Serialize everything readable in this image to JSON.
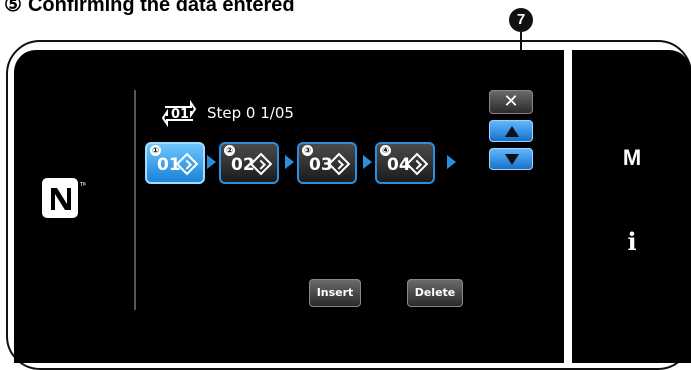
{
  "heading": {
    "number": "⑤",
    "text": "Confirming the data entered"
  },
  "callout": {
    "label": "7"
  },
  "title": {
    "text": "Step 0 1/05",
    "icon": "step-loop-icon"
  },
  "steps": [
    {
      "number": "①",
      "code": "01",
      "state": "active",
      "icon": "diamond-arrow-icon"
    },
    {
      "number": "②",
      "code": "02",
      "state": "inactive",
      "icon": "diamond-arrow-icon"
    },
    {
      "number": "③",
      "code": "03",
      "state": "inactive",
      "icon": "diamond-arrow-icon"
    },
    {
      "number": "④",
      "code": "04",
      "state": "inactive",
      "icon": "diamond-arrow-icon"
    }
  ],
  "buttons": {
    "close": "✕",
    "insert": "Insert",
    "delete": "Delete"
  },
  "side": {
    "menu": "M",
    "info": "i",
    "nfc_icon": "nfc-icon"
  },
  "colors": {
    "accent": "#2b8fe0",
    "active_step": "#3aa6f0",
    "screen_bg": "#000000"
  }
}
